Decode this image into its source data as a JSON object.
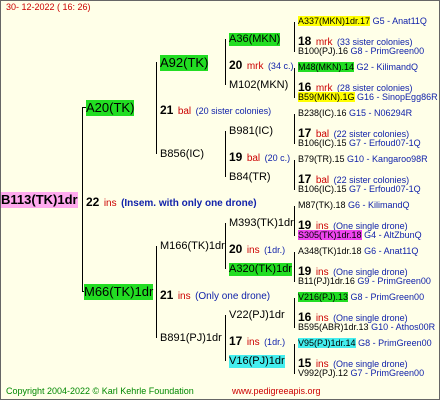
{
  "header": {
    "date": "30-  12-2022  ( 16: 26)"
  },
  "footer": {
    "copyright": "Copyright 2004-2022 © Karl Kehrle Foundation",
    "url": "www.pedigreeapis.org"
  },
  "root": {
    "id": "B113(TK)1dr",
    "num": "22",
    "tag": "ins",
    "note": "(Insem. with only one drone)"
  },
  "gen1": [
    {
      "id": "A20(TK)",
      "num": "21",
      "tag": "bal",
      "note": "(20 sister colonies)"
    },
    {
      "id": "M66(TK)1dr",
      "num": "21",
      "tag": "ins",
      "note": "(Only one drone)"
    }
  ],
  "gen2": [
    {
      "id": "A92(TK)",
      "num": "20",
      "tag": "mrk",
      "note": "(34 c.)"
    },
    {
      "id": "B856(IC)",
      "num": "19",
      "tag": "bal",
      "note": "(20 c.)"
    },
    {
      "id": "M166(TK)1dr",
      "num": "20",
      "tag": "ins",
      "note": "(1dr.)"
    },
    {
      "id": "B891(PJ)1dr",
      "num": "17",
      "tag": "ins",
      "note": "(1dr.)"
    }
  ],
  "gen3": [
    {
      "id": "A36(MKN)",
      "num": "18",
      "tag": "mrk",
      "note": "(33 sister colonies)"
    },
    {
      "id": "M102(MKN)",
      "num": "16",
      "tag": "mrk",
      "note": "(28 sister colonies)"
    },
    {
      "id": "B981(IC)",
      "num": "17",
      "tag": "bal",
      "note": "(22 sister colonies)"
    },
    {
      "id": "B84(TR)",
      "num": "17",
      "tag": "bal",
      "note": "(22 sister colonies)"
    },
    {
      "id": "M393(TK)1dr",
      "num": "19",
      "tag": "ins",
      "note": "(One single drone)"
    },
    {
      "id": "A320(TK)1dr",
      "num": "19",
      "tag": "ins",
      "note": "(One single drone)"
    },
    {
      "id": "V22(PJ)1dr",
      "num": "16",
      "tag": "ins",
      "note": "(One single drone)"
    },
    {
      "id": "V16(PJ)1dr",
      "num": "15",
      "tag": "ins",
      "note": "(One single drone)"
    }
  ],
  "gen4": [
    {
      "id": "A337(MKN)1dr.17",
      "gid": "G5 - Anat11Q"
    },
    {
      "id": "B100(PJ).16",
      "gid": "G8 - PrimGreen00"
    },
    {
      "id": "M48(MKN).14",
      "gid": "G2 - KilimandQ"
    },
    {
      "id": "B59(MKN).1G",
      "gid": "G16 - SinopEgg86R"
    },
    {
      "id": "B238(IC).16",
      "gid": "G15 - N06294R"
    },
    {
      "id": "B106(IC).15",
      "gid": "G7 - Erfoud07-1Q"
    },
    {
      "id": "B79(TR).15",
      "gid": "G10 - Kangaroo98R"
    },
    {
      "id": "B106(IC).15",
      "gid": "G7 - Erfoud07-1Q"
    },
    {
      "id": "M87(TK).18",
      "gid": "G6 - KilimandQ"
    },
    {
      "id": "S305(TK)1dr.18",
      "gid": "G4 - AltZbunQ"
    },
    {
      "id": "A348(TK)1dr.18",
      "gid": "G6 - Anat11Q"
    },
    {
      "id": "B11(PJ)1dr.16",
      "gid": "G9 - PrimGreen00"
    },
    {
      "id": "V216(PJ).13",
      "gid": "G8 - PrimGreen00"
    },
    {
      "id": "B595(ABR)1dr.13",
      "gid": "G10 - Athos00R"
    },
    {
      "id": "V95(PJ)1dr.14",
      "gid": "G8 - PrimGreen00"
    },
    {
      "id": "V992(PJ).12",
      "gid": "G7 - PrimGreen00"
    }
  ]
}
